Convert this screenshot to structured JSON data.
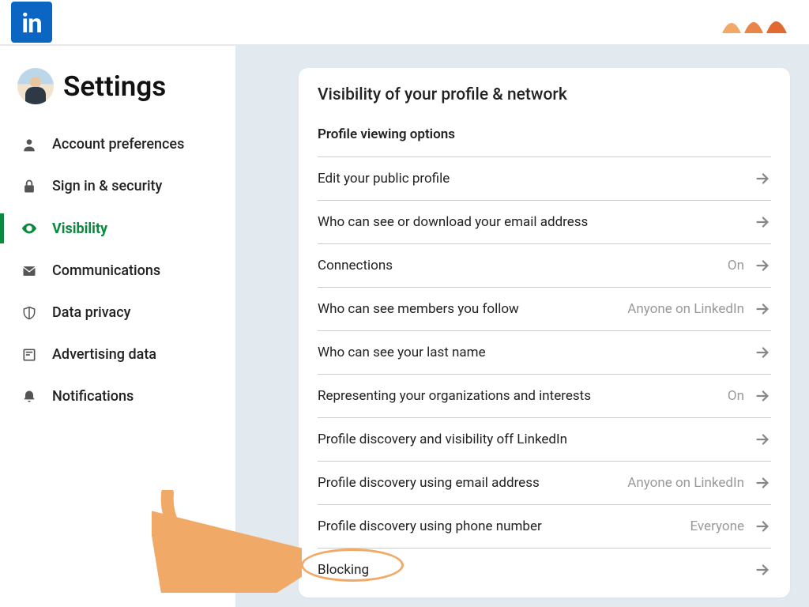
{
  "topbar": {
    "brand": "in"
  },
  "sidebar": {
    "title": "Settings",
    "items": [
      {
        "label": "Account preferences"
      },
      {
        "label": "Sign in & security"
      },
      {
        "label": "Visibility"
      },
      {
        "label": "Communications"
      },
      {
        "label": "Data privacy"
      },
      {
        "label": "Advertising data"
      },
      {
        "label": "Notifications"
      }
    ]
  },
  "panel": {
    "title": "Visibility of your profile & network",
    "subheader": "Profile viewing options",
    "rows": [
      {
        "label": "Edit your public profile",
        "value": ""
      },
      {
        "label": "Who can see or download your email address",
        "value": ""
      },
      {
        "label": "Connections",
        "value": "On"
      },
      {
        "label": "Who can see members you follow",
        "value": "Anyone on LinkedIn"
      },
      {
        "label": "Who can see your last name",
        "value": ""
      },
      {
        "label": "Representing your organizations and interests",
        "value": "On"
      },
      {
        "label": "Profile discovery and visibility off LinkedIn",
        "value": ""
      },
      {
        "label": "Profile discovery using email address",
        "value": "Anyone on LinkedIn"
      },
      {
        "label": "Profile discovery using phone number",
        "value": "Everyone"
      },
      {
        "label": "Blocking",
        "value": ""
      }
    ]
  }
}
